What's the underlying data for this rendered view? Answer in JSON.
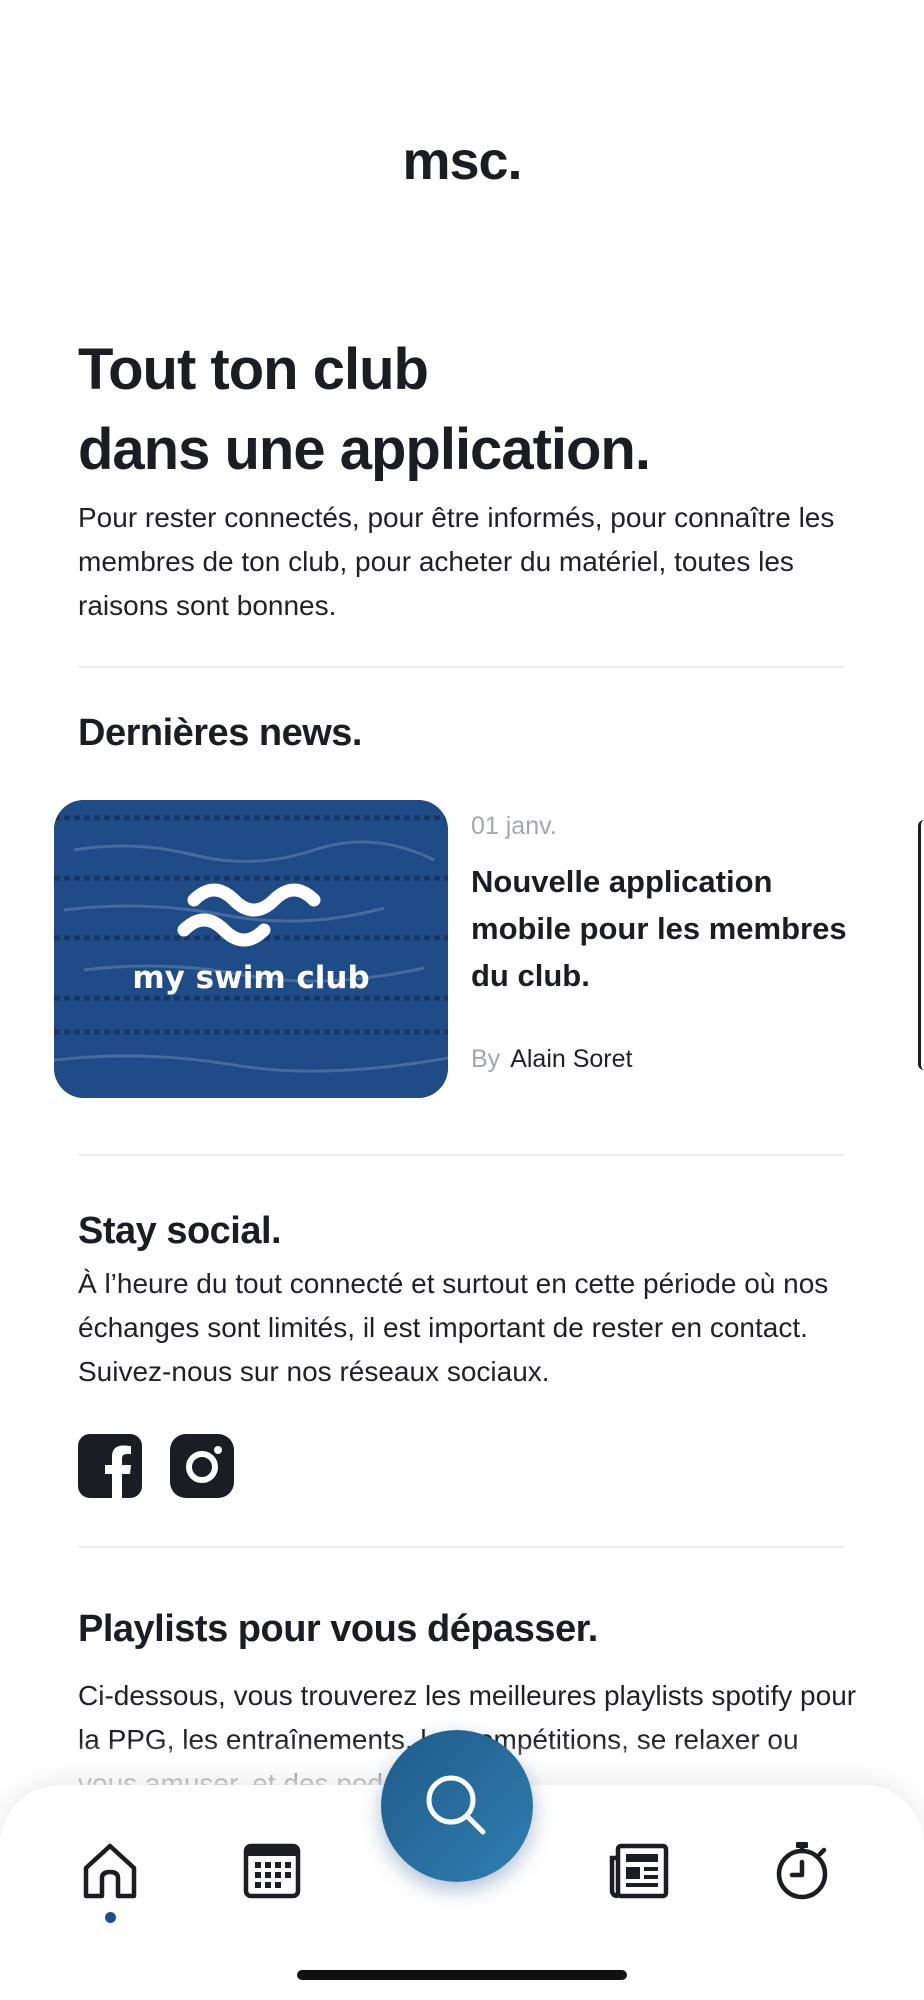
{
  "app": {
    "logo": "msc."
  },
  "hero": {
    "title_line1": "Tout ton club",
    "title_line2": "dans une application.",
    "description": "Pour rester connectés, pour être informés, pour connaître les membres de ton club, pour acheter du matériel, toutes les raisons sont bonnes."
  },
  "news": {
    "section_title": "Dernières news.",
    "items": [
      {
        "image_caption": "my swim club",
        "date": "01 janv.",
        "title": "Nouvelle application mobile pour les membres du club.",
        "by_label": "By",
        "author": "Alain Soret"
      }
    ]
  },
  "social": {
    "section_title": "Stay social.",
    "description": "À l’heure du tout connecté et surtout en cette période où nos échanges sont limités, il est important de rester en contact. Suivez-nous sur nos réseaux sociaux.",
    "icons": [
      "facebook-icon",
      "instagram-icon"
    ]
  },
  "playlists": {
    "section_title": "Playlists pour vous dépasser.",
    "description": "Ci-dessous, vous trouverez les meilleures playlists spotify pour la PPG, les entraînements, les compétitions, se relaxer ou vous amuser, et des podcasts sur le"
  },
  "tab_bar": {
    "tabs": [
      "home-icon",
      "calendar-icon",
      "search-icon",
      "news-icon",
      "stopwatch-icon"
    ],
    "active": "home-icon"
  },
  "colors": {
    "brand_blue": "#1f4b86",
    "fab_blue": "#2a6e9f",
    "text": "#1b1d22",
    "muted": "#a4a7ad"
  }
}
